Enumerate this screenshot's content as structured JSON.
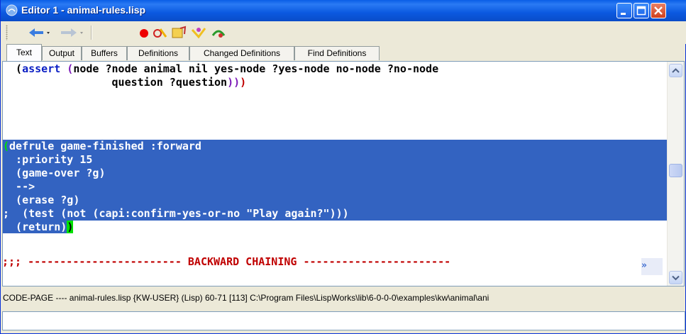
{
  "window": {
    "title": "Editor 1 - animal-rules.lisp",
    "colors": {
      "titlebar": "#0a5ee6",
      "selection": "#3363c1",
      "paren_match": "#00e000"
    }
  },
  "toolbar": {
    "icons": [
      "back-arrow-icon",
      "dropdown-icon",
      "forward-arrow-icon",
      "dropdown-icon",
      "red-dot-icon",
      "compile-icon",
      "open-icon",
      "trace-icon",
      "inspect-icon"
    ]
  },
  "tabs": [
    {
      "label": "Text",
      "active": true
    },
    {
      "label": "Output"
    },
    {
      "label": "Buffers"
    },
    {
      "label": "Definitions"
    },
    {
      "label": "Changed Definitions"
    },
    {
      "label": "Find Definitions"
    }
  ],
  "editor": {
    "lines": {
      "l1_a": "  (",
      "l1_b": "assert",
      "l1_c": " (",
      "l1_d": "node",
      "l1_e": " ?node animal nil yes-node ?yes-node no-node ?no-node",
      "l2_a": "                 question ?question",
      "l2_b": "))",
      "l2_c": ")",
      "l4_a": "(",
      "l4_b": "defrule game-finished :forward",
      "l5": "  :priority 15",
      "l6": "  (game-over ?g)",
      "l7": "  -->",
      "l8": "  (erase ?g)",
      "l9": ";  (test (not (capi:confirm-yes-or-no \"Play again?\")))",
      "l10_a": "  (return)",
      "l10_b": ")",
      "l12": ";;; ------------------------ BACKWARD CHAINING -----------------------",
      "overflow_mark": "»"
    }
  },
  "status": {
    "text": "CODE-PAGE ---- animal-rules.lisp    {KW-USER} (Lisp) 60-71 [113] C:\\Program Files\\LispWorks\\lib\\6-0-0-0\\examples\\kw\\animal\\ani"
  },
  "echo_area": {
    "value": ""
  }
}
